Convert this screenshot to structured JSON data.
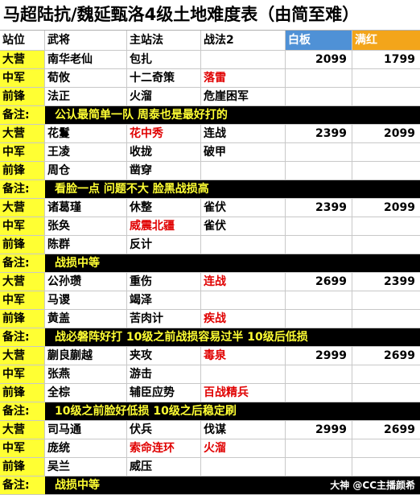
{
  "title": "马超陆抗/魏延甄洛4级土地难度表（由简至难）",
  "headers": [
    "站位",
    "武将",
    "主站法",
    "战法2",
    "白板",
    "满红"
  ],
  "groups": [
    {
      "rows": [
        {
          "pos": "大营",
          "general": "南华老仙",
          "main": "包扎",
          "main_red": false,
          "skill2": "",
          "skill2_red": false,
          "baiban": "2099",
          "manhong": "1799"
        },
        {
          "pos": "中军",
          "general": "荀攸",
          "main": "十二奇策",
          "main_red": false,
          "skill2": "落雷",
          "skill2_red": true,
          "baiban": "",
          "manhong": ""
        },
        {
          "pos": "前锋",
          "general": "法正",
          "main": "火溜",
          "main_red": false,
          "skill2": "危崖困军",
          "skill2_red": false,
          "baiban": "",
          "manhong": ""
        }
      ],
      "note": "公认最简单一队 周泰也是最好打的"
    },
    {
      "rows": [
        {
          "pos": "大营",
          "general": "花鬘",
          "main": "花中秀",
          "main_red": true,
          "skill2": "连战",
          "skill2_red": false,
          "baiban": "2399",
          "manhong": "2099"
        },
        {
          "pos": "中军",
          "general": "王凌",
          "main": "收拢",
          "main_red": false,
          "skill2": "破甲",
          "skill2_red": false,
          "baiban": "",
          "manhong": ""
        },
        {
          "pos": "前锋",
          "general": "周仓",
          "main": "凿穿",
          "main_red": false,
          "skill2": "",
          "skill2_red": false,
          "baiban": "",
          "manhong": ""
        }
      ],
      "note": "看脸一点 问题不大 脸黑战损高"
    },
    {
      "rows": [
        {
          "pos": "大营",
          "general": "诸葛瑾",
          "main": "休整",
          "main_red": false,
          "skill2": "雀伏",
          "skill2_red": false,
          "baiban": "2399",
          "manhong": "2099"
        },
        {
          "pos": "中军",
          "general": "张奂",
          "main": "威震北疆",
          "main_red": true,
          "skill2": "雀伏",
          "skill2_red": false,
          "baiban": "",
          "manhong": ""
        },
        {
          "pos": "前锋",
          "general": "陈群",
          "main": "反计",
          "main_red": false,
          "skill2": "",
          "skill2_red": false,
          "baiban": "",
          "manhong": ""
        }
      ],
      "note": "战损中等"
    },
    {
      "rows": [
        {
          "pos": "大营",
          "general": "公孙瓒",
          "main": "重伤",
          "main_red": false,
          "skill2": "连战",
          "skill2_red": true,
          "baiban": "2699",
          "manhong": "2399"
        },
        {
          "pos": "中军",
          "general": "马谡",
          "main": "竭泽",
          "main_red": false,
          "skill2": "",
          "skill2_red": false,
          "baiban": "",
          "manhong": ""
        },
        {
          "pos": "前锋",
          "general": "黄盖",
          "main": "苦肉计",
          "main_red": false,
          "skill2": "疾战",
          "skill2_red": true,
          "baiban": "",
          "manhong": ""
        }
      ],
      "note": "战必磐阵好打 10级之前战损容易过半 10级后低损"
    },
    {
      "rows": [
        {
          "pos": "大营",
          "general": "蒯良蒯越",
          "main": "夹攻",
          "main_red": false,
          "skill2": "毒泉",
          "skill2_red": true,
          "baiban": "2999",
          "manhong": "2699"
        },
        {
          "pos": "中军",
          "general": "张燕",
          "main": "游击",
          "main_red": false,
          "skill2": "",
          "skill2_red": false,
          "baiban": "",
          "manhong": ""
        },
        {
          "pos": "前锋",
          "general": "全棕",
          "main": "辅臣应势",
          "main_red": false,
          "skill2": "百战精兵",
          "skill2_red": true,
          "baiban": "",
          "manhong": ""
        }
      ],
      "note": "10级之前脸好低损 10级之后稳定刷"
    },
    {
      "rows": [
        {
          "pos": "大营",
          "general": "司马通",
          "main": "伏兵",
          "main_red": false,
          "skill2": "伐谋",
          "skill2_red": false,
          "baiban": "2999",
          "manhong": "2699"
        },
        {
          "pos": "中军",
          "general": "庞统",
          "main": "索命连环",
          "main_red": true,
          "skill2": "火溜",
          "skill2_red": true,
          "baiban": "",
          "manhong": ""
        },
        {
          "pos": "前锋",
          "general": "吴兰",
          "main": "威压",
          "main_red": false,
          "skill2": "",
          "skill2_red": false,
          "baiban": "",
          "manhong": ""
        }
      ],
      "note": "战损中等"
    }
  ],
  "note_label": "备注:",
  "watermark": "大神 @CC主播颜希",
  "colors": {
    "position_bg": "#ffff33",
    "note_bg": "#000000",
    "note_text": "#ffff33",
    "baiban_header": "#4f91d6",
    "manhong_header": "#f3a51a",
    "red_text": "#e00000"
  }
}
